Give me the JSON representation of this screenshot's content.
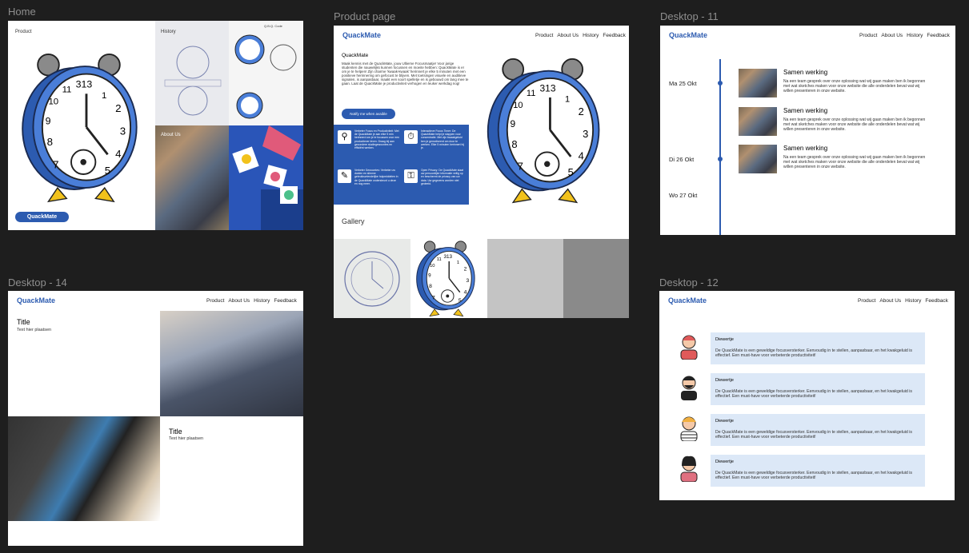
{
  "frames": {
    "home": "Home",
    "product_page": "Product page",
    "desktop11": "Desktop - 11",
    "desktop14": "Desktop - 14",
    "desktop12": "Desktop - 12"
  },
  "home": {
    "product_label": "Product",
    "history_label": "History",
    "about_label": "About Us",
    "button": "QuackMate",
    "clock_number": "313",
    "sticky_notes": "Q.B.Q. Code"
  },
  "nav": {
    "logo": "QuackMate",
    "items": [
      "Product",
      "About Us",
      "History",
      "Feedback"
    ]
  },
  "product_page": {
    "heading": "QuackMate",
    "body": "Maak kennis met de QuackMate, jouw Ultieme Focusmaatje! Voor jarige studenten die nauwelijks kunnen focussen en moeite hebben: QuackMate is er om je te helpen! Zijn charme 'kwaak-kwaak' herinnert je elke 5 minuten met een positieve herinnering om gefocust te blijven. Met toetsingen visuele en auditieve signalen, is aanpasbaar, maakt een soort spelletje en is gebouwd om lang mee te gaan. Laat de QuackMate je productiviteit verhogen en leuker werkdag nog!",
    "button": "Notify me when avaible",
    "features": [
      "Verbeter Focus en Productiviteit: Met de QuackMate je aan elke 5 min herinnerd om je te focussen voor een productiever leven. Draag bij aan gezondere studiegewoontes en efficiënt werken.",
      "Interactieve Focus Timer: De QuackMate helpt je stappen voor concentratie. Met zijn kwaakgeluid ben je gemotiveerd om door te werken. Elke 5 minuten herinnert hij je.",
      "Verbeter Gewoontes: Verbeter uw doelen en slimme gebruiksvriendelijke hulpmiddelen in de QuackMate ondersteunt u deze en nog meer.",
      "Open Privacy: De QuackMate slaat uw persoonlijke informatie veilig op en beschermt de privacy van uw data. Uw gegevens worden niet gedeeld."
    ],
    "gallery": "Gallery"
  },
  "desktop11": {
    "dates": [
      "Ma 25 Okt",
      "Di 26 Okt",
      "Wo 27 Okt"
    ],
    "entries": [
      {
        "title": "Samen werking",
        "text": "Na een team gesprek over onze oplossing wat wij gaan maken ben ik begonnen met wat sketches maken voor onze website die alle onderdelen bevat wat wij willen presenteren in onze website."
      },
      {
        "title": "Samen werking",
        "text": "Na een team gesprek over onze oplossing wat wij gaan maken ben ik begonnen met wat sketches maken voor onze website die alle onderdelen bevat wat wij willen presenteren in onze website."
      },
      {
        "title": "Samen werking",
        "text": "Na een team gesprek over onze oplossing wat wij gaan maken ben ik begonnen met wat sketches maken voor onze website die alle onderdelen bevat wat wij willen presenteren in onze website."
      }
    ]
  },
  "desktop14": {
    "title1": "Title",
    "text1": "Text hier plaatsen",
    "title2": "Title",
    "text2": "Text hier plaatsen"
  },
  "desktop12": {
    "reviews": [
      {
        "name": "Diewertje",
        "text": "De QuackMate is een geweldige focusversterker. Eenvoudig in te stellen, aanpasbaar, en het kwakgeluid is effectief. Een must-have voor verbeterde productiviteit!"
      },
      {
        "name": "Diewertje",
        "text": "De QuackMate is een geweldige focusversterker. Eenvoudig in te stellen, aanpasbaar, en het kwakgeluid is effectief. Een must-have voor verbeterde productiviteit!"
      },
      {
        "name": "Diewertje",
        "text": "De QuackMate is een geweldige focusversterker. Eenvoudig in te stellen, aanpasbaar, en het kwakgeluid is effectief. Een must-have voor verbeterde productiviteit!"
      },
      {
        "name": "Diewertje",
        "text": "De QuackMate is een geweldige focusversterker. Eenvoudig in te stellen, aanpasbaar, en het kwakgeluid is effectief. Een must-have voor verbeterde productiviteit!"
      }
    ]
  }
}
